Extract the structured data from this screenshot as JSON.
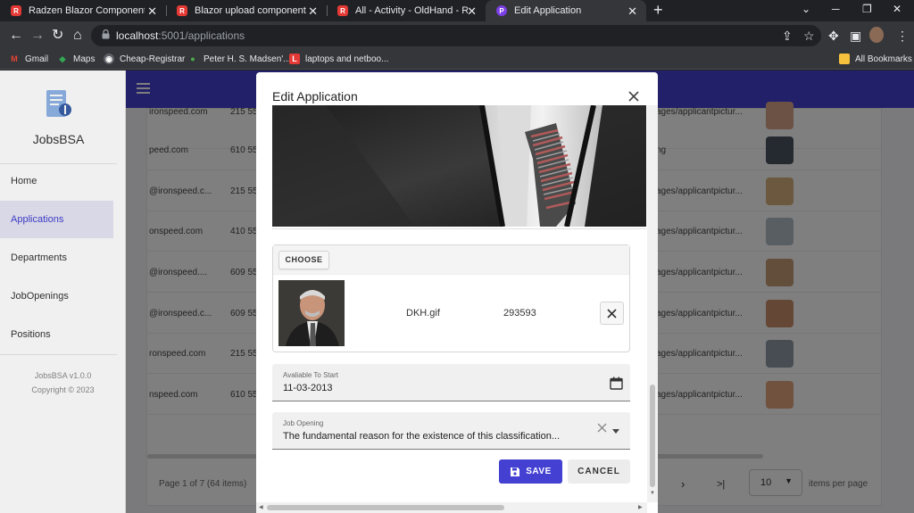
{
  "browser": {
    "tabs": [
      {
        "title": "Radzen Blazor Components",
        "icon": "radzen-icon",
        "color": "#e53935",
        "active": false
      },
      {
        "title": "Blazor upload component",
        "icon": "radzen-icon",
        "color": "#e53935",
        "active": false
      },
      {
        "title": "All - Activity - OldHand - Radzen",
        "icon": "radzen-icon",
        "color": "#e53935",
        "active": false
      },
      {
        "title": "Edit Application",
        "icon": "app-icon",
        "color": "#7b3fe4",
        "active": true
      }
    ],
    "url_host": "localhost",
    "url_rest": ":5001/applications",
    "bookmarks": [
      "Gmail",
      "Maps",
      "Cheap-Registrar",
      "Peter H. S. Madsen'...",
      "laptops and netboo...",
      "All Bookmarks"
    ]
  },
  "app": {
    "brand": "JobsBSA",
    "nav": [
      "Home",
      "Applications",
      "Departments",
      "JobOpenings",
      "Positions"
    ],
    "active_nav": "Applications",
    "version": "JobsBSA v1.0.0",
    "copyright": "Copyright © 2023",
    "accent": "#4340d2"
  },
  "table": {
    "rows": [
      {
        "email": "ironspeed.com",
        "phone": "215 55",
        "picture": "ages/applicantpictur..."
      },
      {
        "email": "peed.com",
        "phone": "610 55",
        "picture": "ng"
      },
      {
        "email": "@ironspeed.c...",
        "phone": "215 55",
        "picture": "ages/applicantpictur..."
      },
      {
        "email": "onspeed.com",
        "phone": "410 55",
        "picture": "ages/applicantpictur..."
      },
      {
        "email": "@ironspeed....",
        "phone": "609 55",
        "picture": "ages/applicantpictur..."
      },
      {
        "email": "@ironspeed.c...",
        "phone": "609 55",
        "picture": "ages/applicantpictur..."
      },
      {
        "email": "ronspeed.com",
        "phone": "215 55",
        "picture": "ages/applicantpictur..."
      },
      {
        "email": "nspeed.com",
        "phone": "610 55",
        "picture": "ages/applicantpictur..."
      }
    ],
    "pager_info": "Page 1 of 7 (64 items)",
    "page_size": "10",
    "items_per_page": "items per page"
  },
  "dialog": {
    "title": "Edit Application",
    "choose_label": "CHOOSE",
    "file_name": "DKH.gif",
    "file_size": "293593",
    "available_label": "Avaliable To Start",
    "available_value": "11-03-2013",
    "job_label": "Job Opening",
    "job_value": "The fundamental reason for the existence of this classification...",
    "save_label": "SAVE",
    "cancel_label": "CANCEL"
  }
}
